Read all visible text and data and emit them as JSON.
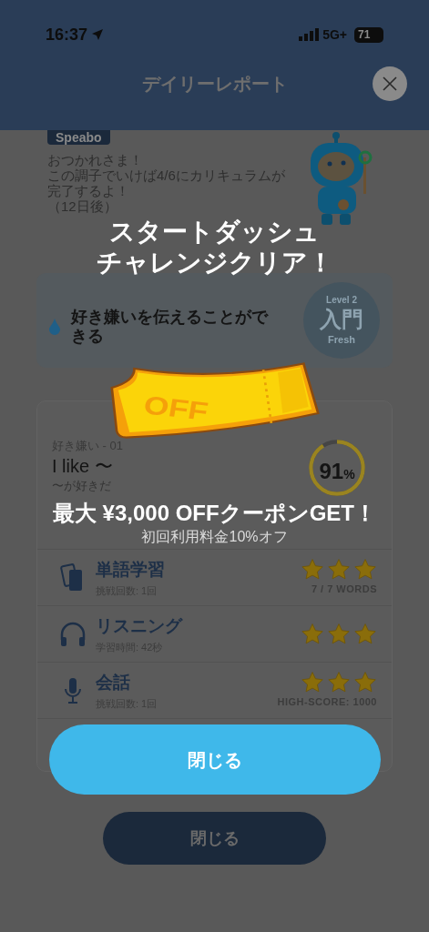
{
  "status_bar": {
    "time": "16:37",
    "network": "5G+",
    "battery": "71"
  },
  "header": {
    "title": "デイリーレポート"
  },
  "message": {
    "tag": "Speabo",
    "lines": [
      "おつかれさま！",
      "この調子でいけば4/6にカリキュラムが完了するよ！",
      "（12日後）"
    ]
  },
  "cando": {
    "title": "好き嫌いを伝えることができる",
    "level_label": "Level 2",
    "level_name": "入門",
    "level_sub": "Fresh"
  },
  "lesson": {
    "category": "好き嫌い - 01",
    "phrase": "I like 〜",
    "meaning": "〜が好きだ",
    "score": "91",
    "score_unit": "%",
    "level": 0.91
  },
  "activities": [
    {
      "kind": "cards",
      "title": "単語学習",
      "detail": "挑戦回数: 1回",
      "stars": 3,
      "result": "7 / 7 WORDS"
    },
    {
      "kind": "headphones",
      "title": "リスニング",
      "detail": "学習時間: 42秒",
      "stars": 3
    },
    {
      "kind": "mic",
      "title": "会話",
      "detail": "挑戦回数: 1回",
      "stars": 3,
      "result": "HIGH-SCORE: 1000"
    }
  ],
  "bottom_button": "閉じる",
  "popup": {
    "title_lines": [
      "スタートダッシュ",
      "チャレンジクリア！"
    ],
    "ticket_text": "OFF",
    "headline": "最大 ¥3,000 OFFクーポンGET！",
    "subline": "初回利用料金10%オフ",
    "button": "閉じる"
  }
}
